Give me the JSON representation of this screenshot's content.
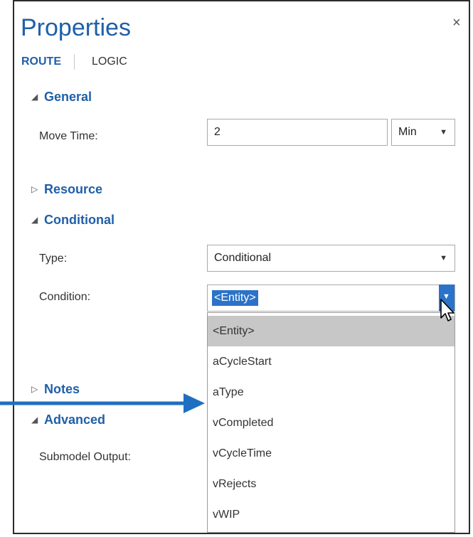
{
  "panel": {
    "title": "Properties",
    "close_glyph": "×",
    "tabs": {
      "route": "ROUTE",
      "logic": "LOGIC"
    }
  },
  "general": {
    "header": "General",
    "expanded": true,
    "move_time_label": "Move Time:",
    "move_time_value": "2",
    "move_time_unit": "Min"
  },
  "resource": {
    "header": "Resource",
    "expanded": false
  },
  "conditional": {
    "header": "Conditional",
    "expanded": true,
    "type_label": "Type:",
    "type_value": "Conditional",
    "condition_label": "Condition:",
    "condition_value": "<Entity>",
    "options": [
      "<Entity>",
      "aCycleStart",
      "aType",
      "vCompleted",
      "vCycleTime",
      "vRejects",
      "vWIP"
    ],
    "selected_option": "<Entity>"
  },
  "notes": {
    "header": "Notes",
    "expanded": false
  },
  "advanced": {
    "header": "Advanced",
    "expanded": true,
    "submodel_output_label": "Submodel Output:"
  },
  "icons": {
    "expanded": "triangle-down-icon",
    "collapsed": "triangle-right-icon",
    "dropdown": "chevron-down-icon",
    "cursor": "mouse-pointer-icon",
    "annotation": "blue-arrow-icon"
  },
  "colors": {
    "accent": "#1f5fa8",
    "selection": "#2b73c8",
    "selected_item_bg": "#c7c7c7",
    "arrow": "#1f6fc1"
  }
}
